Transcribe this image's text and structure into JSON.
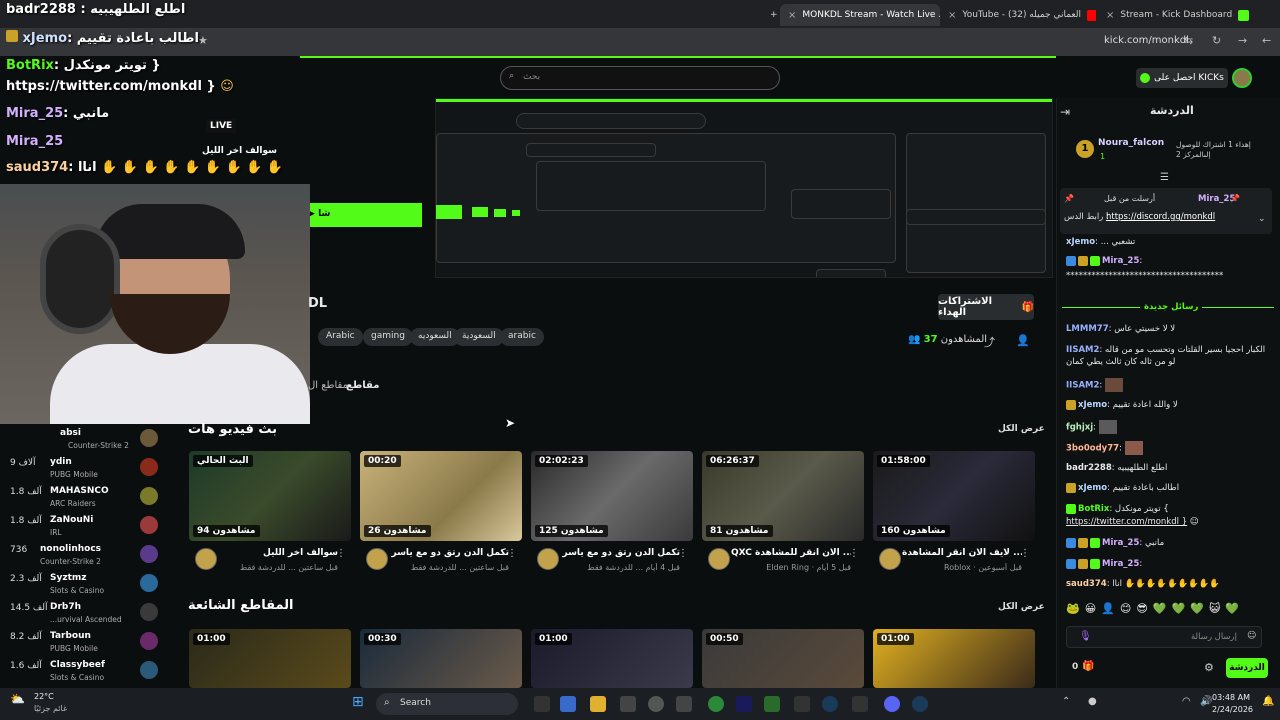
{
  "browser": {
    "tabs": [
      {
        "label": "MONKDL Stream - Watch Live ...",
        "close": "×"
      },
      {
        "label": "YouTube - العماني جميله (32)",
        "close": "×"
      },
      {
        "label": "Stream - Kick Dashboard",
        "close": "×"
      }
    ],
    "new_tab": "+",
    "url": "kick.com/monkdl"
  },
  "header": {
    "search_placeholder": "بحث",
    "kick_button": "احصل على KICKs"
  },
  "stream": {
    "live_badge": "LIVE",
    "title_fragment": "DL",
    "subscriptions_button": "الاشتراكات الهداء",
    "viewers_count": "37",
    "viewers_label": "المشاهدون",
    "tags": [
      "arabic",
      "السعودية",
      "السعوديه",
      "gaming",
      "Arabic"
    ],
    "tab_clips": "مقاطع",
    "tab_other": "مقاطع ال"
  },
  "vods": {
    "section_title": "بث فيديو هات",
    "see_all": "عرض الكل",
    "items": [
      {
        "time": "",
        "views": "94 مشاهدون",
        "title": "سوالف اخر الليل",
        "sub": "قبل ساعتين ... للدردشة فقط",
        "thumb_label": "البث الحالي"
      },
      {
        "time": "00:20",
        "views": "26 مشاهدون",
        "title": "تكمل الدن رتق دو مع ياسر",
        "sub": "قبل ساعتين ... للدردشة فقط"
      },
      {
        "time": "02:02:23",
        "views": "125 مشاهدون",
        "title": "تكمل الدن رتق دو مع ياسر",
        "sub": "قبل 4 أيام ... للدردشة فقط"
      },
      {
        "time": "06:26:37",
        "views": "81 مشاهدون",
        "title": "QXC الان انقر للمشاهدة ...",
        "sub": "Elden Ring · قبل 5 أيام"
      },
      {
        "time": "01:58:00",
        "views": "160 مشاهدون",
        "title": "لايف الان انقر المشاهدة ...",
        "sub": "Roblox · قبل أسبوعين"
      }
    ]
  },
  "clips": {
    "section_title": "المقاطع الشائعة",
    "see_all": "عرض الكل",
    "items": [
      {
        "time": "01:00"
      },
      {
        "time": "00:30"
      },
      {
        "time": "01:00"
      },
      {
        "time": "00:50"
      },
      {
        "time": "01:00"
      }
    ]
  },
  "sidebar": {
    "items": [
      {
        "count": "",
        "name": "absi",
        "game": "Counter-Strike 2",
        "color": "#6b5a3a"
      },
      {
        "count": "9 آلاف",
        "name": "ydin",
        "game": "PUBG Mobile",
        "color": "#8a2a1a"
      },
      {
        "count": "1.8 آلف",
        "name": "MAHASNCO",
        "game": "ARC Raiders",
        "color": "#7a7a2a"
      },
      {
        "count": "1.8 آلف",
        "name": "ZaNouNi",
        "game": "IRL",
        "color": "#9a3a3a"
      },
      {
        "count": "736",
        "name": "nonolinhocs",
        "game": "Counter-Strike 2",
        "color": "#5a3a8a"
      },
      {
        "count": "2.3 آلف",
        "name": "Syztmz",
        "game": "Slots & Casino",
        "color": "#2a6a9a"
      },
      {
        "count": "14.5 آلف",
        "name": "Drb7h",
        "game": "...urvival Ascended",
        "color": "#3a3a3a"
      },
      {
        "count": "8.2 آلف",
        "name": "Tarboun",
        "game": "PUBG Mobile",
        "color": "#6a2a6a"
      },
      {
        "count": "1.6 آلف",
        "name": "Classybeef",
        "game": "Slots & Casino",
        "color": "#2a5a7a"
      }
    ]
  },
  "overlay_chat": [
    {
      "user": "badr2288",
      "text": ": اطلع الطلهيبيه"
    },
    {
      "user": "xJemo",
      "text": ": اطالب باعادة تقييم"
    },
    {
      "user": "BotRix",
      "text": ": تويتر مونكدل }"
    },
    {
      "user": "",
      "text": "https://twitter.com/monkdl }"
    },
    {
      "user": "Mira_25",
      "text": ": مانبي"
    },
    {
      "user": "Mira_25",
      "text": ""
    },
    {
      "user": "saud374",
      "text": ": اناا"
    }
  ],
  "overlay_preview_label": "سوالف اخر الليل",
  "chat": {
    "title": "الدردشة",
    "top_gifter": "Noura_falcon",
    "top_gifter_count": "1",
    "gift_text": "إهداء 1 اشتراك للوصول إلىالمركز 2",
    "pinned_user": "Mira_25",
    "pinned_by": "أرسلت من قبل",
    "pinned_text": "رابط الدس :",
    "pinned_link": "https://discord.gg/monkdl",
    "new_messages": "رسائل جديدة",
    "messages": [
      {
        "user": "xJemo",
        "text": "... تشعبي",
        "color": "#b8d6ff"
      },
      {
        "user": "Mira_25",
        "text": "",
        "color": "#d4b0ff"
      },
      {
        "user": "",
        "text": "*************************************",
        "color": "#e8e8e8"
      },
      {
        "user": "LMMM77",
        "text": "لا لا خسيتي عاس",
        "color": "#9ab0ff"
      },
      {
        "user": "IISAM2",
        "text": "الكبار احجيا بسير القلتات وتحسب مو من قاله لو من ثاله كان ثالث يطي كمان",
        "color": "#9ab0ff"
      },
      {
        "user": "IISAM2",
        "text": "",
        "color": "#9ab0ff"
      },
      {
        "user": "xJemo",
        "text": "لا والله اعادة تقييم",
        "color": "#b8d6ff"
      },
      {
        "user": "fghjxj",
        "text": "",
        "color": "#b8f0b8"
      },
      {
        "user": "3bo0ody77",
        "text": "",
        "color": "#ffb890"
      },
      {
        "user": "badr2288",
        "text": "اطلع الطلهيبيه",
        "color": "#e8e8e8"
      },
      {
        "user": "xJemo",
        "text": "اطالب باعادة تقييم",
        "color": "#b8d6ff"
      },
      {
        "user": "BotRix",
        "text": "تويتر مونكدل {",
        "color": "#53fc18"
      },
      {
        "user": "",
        "text": "https://twitter.com/monkdl }",
        "color": "#e8e8e8"
      },
      {
        "user": "Mira_25",
        "text": "مانبي",
        "color": "#d4b0ff"
      },
      {
        "user": "Mira_25",
        "text": "",
        "color": "#d4b0ff"
      },
      {
        "user": "saud374",
        "text": "اناا",
        "color": "#ffd0a0"
      }
    ],
    "input_placeholder": "إرسال رسالة",
    "send_button": "الدردشة",
    "points": "0"
  },
  "taskbar": {
    "temp": "22°C",
    "weather": "غائم جزئيًا",
    "search": "Search",
    "time": "03:48 AM",
    "date": "2/24/2026"
  },
  "colors": {
    "accent": "#53fc18",
    "background": "#0b0e0f",
    "chat_bg": "#0e1112"
  }
}
